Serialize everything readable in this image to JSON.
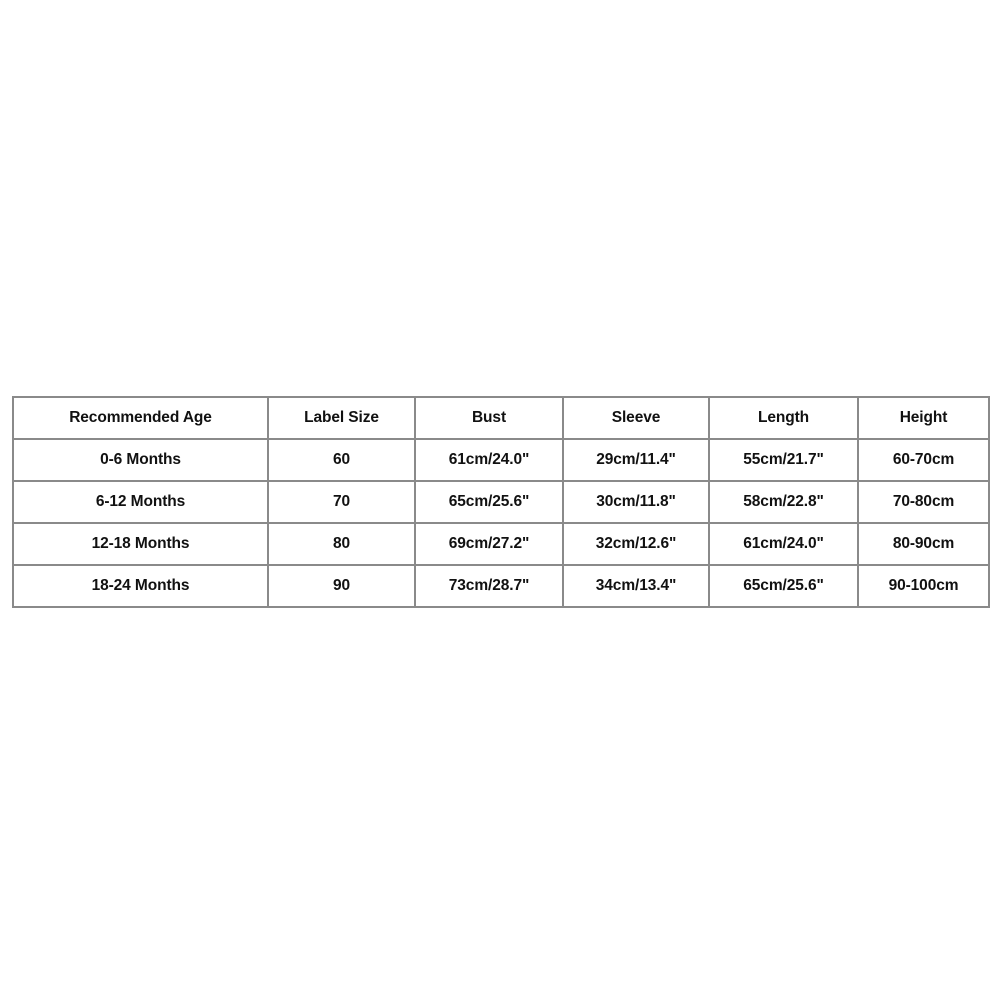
{
  "table": {
    "columns": [
      "Recommended Age",
      "Label Size",
      "Bust",
      "Sleeve",
      "Length",
      "Height"
    ],
    "rows": [
      {
        "age": "0-6 Months",
        "label_size": "60",
        "bust": "61cm/24.0\"",
        "sleeve": "29cm/11.4\"",
        "length": "55cm/21.7\"",
        "height": "60-70cm"
      },
      {
        "age": "6-12 Months",
        "label_size": "70",
        "bust": "65cm/25.6\"",
        "sleeve": "30cm/11.8\"",
        "length": "58cm/22.8\"",
        "height": "70-80cm"
      },
      {
        "age": "12-18 Months",
        "label_size": "80",
        "bust": "69cm/27.2\"",
        "sleeve": "32cm/12.6\"",
        "length": "61cm/24.0\"",
        "height": "80-90cm"
      },
      {
        "age": "18-24 Months",
        "label_size": "90",
        "bust": "73cm/28.7\"",
        "sleeve": "34cm/13.4\"",
        "length": "65cm/25.6\"",
        "height": "90-100cm"
      }
    ],
    "colors": {
      "border": "#8a8a8a",
      "text": "#111111",
      "background": "#ffffff"
    }
  }
}
